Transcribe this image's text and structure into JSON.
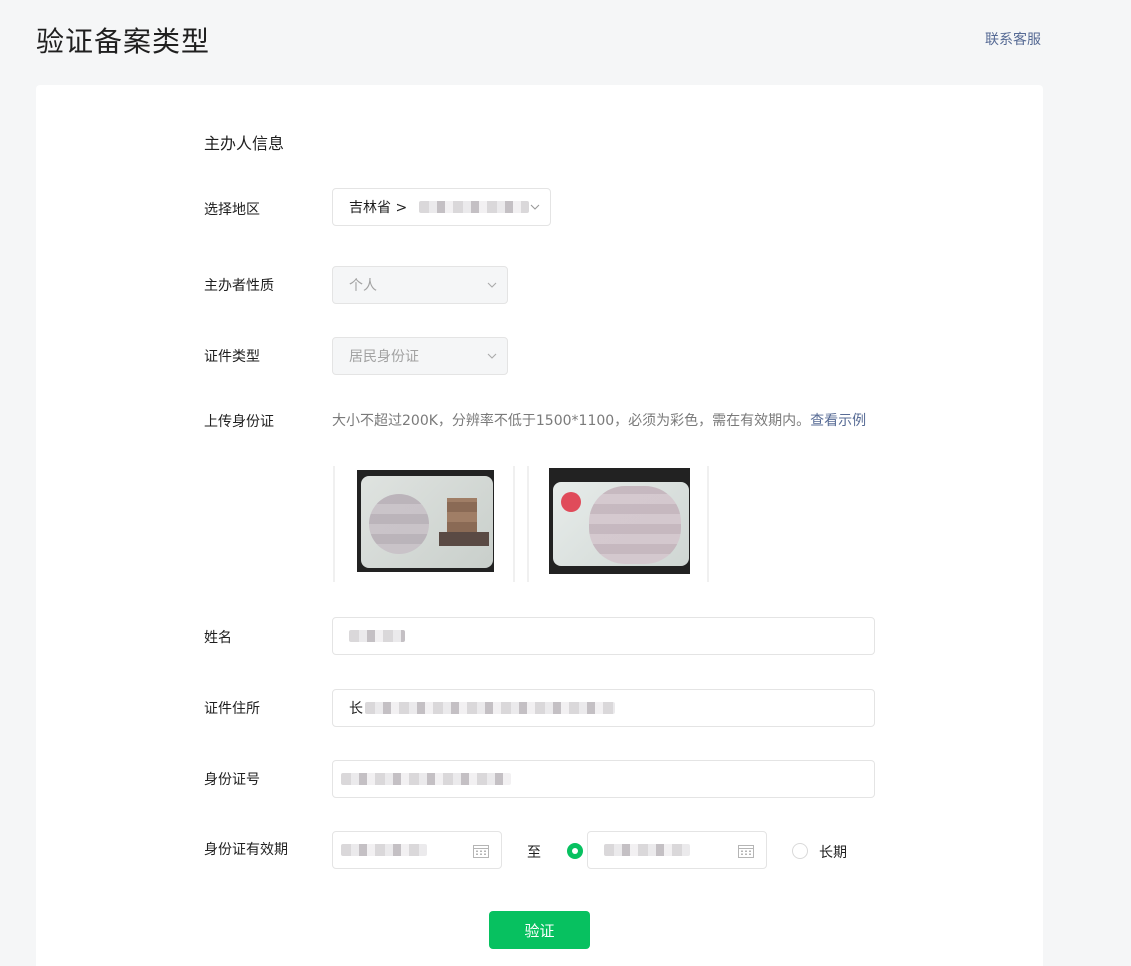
{
  "header": {
    "title": "验证备案类型",
    "contact": "联系客服"
  },
  "section": {
    "title": "主办人信息"
  },
  "fields": {
    "region": {
      "label": "选择地区",
      "value": "吉林省 >"
    },
    "nature": {
      "label": "主办者性质",
      "value": "个人"
    },
    "cert_type": {
      "label": "证件类型",
      "value": "居民身份证"
    },
    "upload": {
      "label": "上传身份证",
      "hint": "大小不超过200K，分辨率不低于1500*1100，必须为彩色，需在有效期内。",
      "example_link": "查看示例"
    },
    "name": {
      "label": "姓名"
    },
    "address": {
      "label": "证件住所",
      "value_prefix": "长"
    },
    "id_number": {
      "label": "身份证号"
    },
    "validity": {
      "label": "身份证有效期",
      "to": "至",
      "long_term": "长期"
    }
  },
  "submit": {
    "label": "验证"
  },
  "colors": {
    "accent": "#07c160",
    "link": "#576b95"
  },
  "icons": {
    "chevron": "chevron-down-icon",
    "calendar": "calendar-icon"
  }
}
